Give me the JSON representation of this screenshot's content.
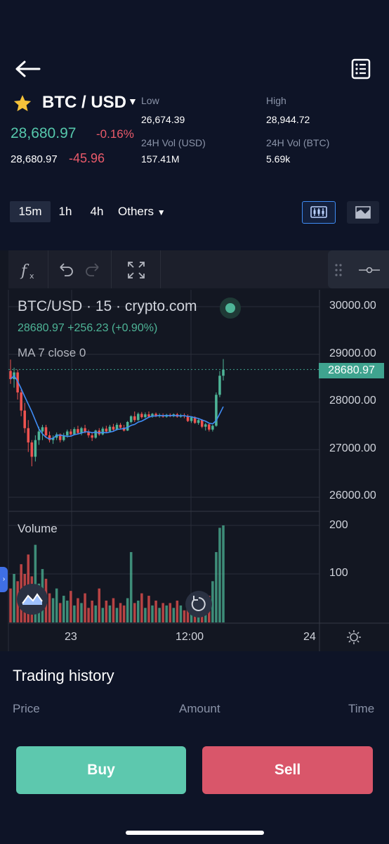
{
  "header": {
    "back_icon": "arrow-left-icon",
    "menu_icon": "order-list-icon",
    "favorite_icon": "star-icon",
    "pair": "BTC / USD",
    "last_price": "28,680.97",
    "change_pct": "-0.16%",
    "mark_price": "28,680.97",
    "change_abs": "-45.96",
    "stats": {
      "low_label": "Low",
      "low_value": "26,674.39",
      "high_label": "High",
      "high_value": "28,944.72",
      "vol_usd_label": "24H Vol (USD)",
      "vol_usd_value": "157.41M",
      "vol_btc_label": "24H Vol (BTC)",
      "vol_btc_value": "5.69k"
    }
  },
  "intervals": {
    "items": [
      "15m",
      "1h",
      "4h",
      "Others"
    ],
    "active": "15m"
  },
  "chart_toolbar": {
    "indicator_icon": "function-fx-icon",
    "undo_icon": "undo-icon",
    "redo_icon": "redo-icon",
    "fullscreen_icon": "fullscreen-icon",
    "drag_icon": "drag-handle-icon",
    "drawing_icon": "horizontal-line-tool-icon"
  },
  "chart": {
    "legend_title": "BTC/USD · 15 · crypto.com",
    "legend_quote": "28680.97 +256.23 (+0.90%)",
    "legend_ma": "MA 7 close 0",
    "current_price_tag": "28680.97",
    "volume_label": "Volume",
    "y_ticks": [
      "30000.00",
      "29000.00",
      "28000.00",
      "27000.00",
      "26000.00"
    ],
    "volume_ticks": [
      "200",
      "100"
    ],
    "x_ticks": [
      "23",
      "12:00",
      "24"
    ]
  },
  "chart_data": {
    "type": "candlestick",
    "symbol": "BTC/USD",
    "interval": "15",
    "ylim": [
      25700,
      30400
    ],
    "current_price": 28680.97,
    "ma": {
      "name": "MA 7 close 0",
      "period": 7,
      "color": "#3f8cf5"
    },
    "colors": {
      "up": "#4eb597",
      "down": "#ef5350"
    },
    "candles": [
      {
        "o": 28650,
        "h": 28890,
        "c": 28480,
        "l": 28380
      },
      {
        "o": 28480,
        "h": 28720,
        "c": 28620,
        "l": 28300
      },
      {
        "o": 28620,
        "h": 28680,
        "c": 28200,
        "l": 28050
      },
      {
        "o": 28200,
        "h": 28260,
        "c": 27820,
        "l": 27700
      },
      {
        "o": 27820,
        "h": 27980,
        "c": 27450,
        "l": 27350
      },
      {
        "o": 27450,
        "h": 27620,
        "c": 27150,
        "l": 26950
      },
      {
        "o": 27150,
        "h": 27200,
        "c": 26850,
        "l": 26650
      },
      {
        "o": 26850,
        "h": 27300,
        "c": 27200,
        "l": 26750
      },
      {
        "o": 27200,
        "h": 27480,
        "c": 27380,
        "l": 27100
      },
      {
        "o": 27380,
        "h": 27520,
        "c": 27470,
        "l": 27200
      },
      {
        "o": 27470,
        "h": 27520,
        "c": 27300,
        "l": 27250
      },
      {
        "o": 27300,
        "h": 27380,
        "c": 27200,
        "l": 27150
      },
      {
        "o": 27200,
        "h": 27300,
        "c": 27250,
        "l": 27120
      },
      {
        "o": 27250,
        "h": 27360,
        "c": 27320,
        "l": 27200
      },
      {
        "o": 27320,
        "h": 27340,
        "c": 27200,
        "l": 27150
      },
      {
        "o": 27200,
        "h": 27350,
        "c": 27300,
        "l": 27170
      },
      {
        "o": 27300,
        "h": 27420,
        "c": 27380,
        "l": 27250
      },
      {
        "o": 27380,
        "h": 27430,
        "c": 27320,
        "l": 27280
      },
      {
        "o": 27320,
        "h": 27470,
        "c": 27430,
        "l": 27300
      },
      {
        "o": 27430,
        "h": 27500,
        "c": 27350,
        "l": 27320
      },
      {
        "o": 27350,
        "h": 27480,
        "c": 27450,
        "l": 27300
      },
      {
        "o": 27450,
        "h": 27520,
        "c": 27380,
        "l": 27340
      },
      {
        "o": 27380,
        "h": 27420,
        "c": 27300,
        "l": 27250
      },
      {
        "o": 27300,
        "h": 27360,
        "c": 27250,
        "l": 27180
      },
      {
        "o": 27250,
        "h": 27420,
        "c": 27400,
        "l": 27230
      },
      {
        "o": 27400,
        "h": 27450,
        "c": 27320,
        "l": 27290
      },
      {
        "o": 27320,
        "h": 27480,
        "c": 27440,
        "l": 27300
      },
      {
        "o": 27440,
        "h": 27500,
        "c": 27380,
        "l": 27350
      },
      {
        "o": 27380,
        "h": 27520,
        "c": 27480,
        "l": 27360
      },
      {
        "o": 27480,
        "h": 27540,
        "c": 27420,
        "l": 27390
      },
      {
        "o": 27420,
        "h": 27560,
        "c": 27520,
        "l": 27400
      },
      {
        "o": 27520,
        "h": 27560,
        "c": 27460,
        "l": 27430
      },
      {
        "o": 27460,
        "h": 27520,
        "c": 27400,
        "l": 27380
      },
      {
        "o": 27400,
        "h": 27600,
        "c": 27580,
        "l": 27390
      },
      {
        "o": 27580,
        "h": 27720,
        "c": 27700,
        "l": 27550
      },
      {
        "o": 27700,
        "h": 27800,
        "c": 27620,
        "l": 27580
      },
      {
        "o": 27620,
        "h": 27780,
        "c": 27750,
        "l": 27600
      },
      {
        "o": 27750,
        "h": 27790,
        "c": 27680,
        "l": 27650
      },
      {
        "o": 27680,
        "h": 27780,
        "c": 27740,
        "l": 27660
      },
      {
        "o": 27740,
        "h": 27800,
        "c": 27690,
        "l": 27670
      },
      {
        "o": 27690,
        "h": 27770,
        "c": 27750,
        "l": 27670
      },
      {
        "o": 27750,
        "h": 27780,
        "c": 27700,
        "l": 27680
      },
      {
        "o": 27700,
        "h": 27760,
        "c": 27720,
        "l": 27670
      },
      {
        "o": 27720,
        "h": 27760,
        "c": 27690,
        "l": 27670
      },
      {
        "o": 27690,
        "h": 27750,
        "c": 27730,
        "l": 27670
      },
      {
        "o": 27730,
        "h": 27760,
        "c": 27700,
        "l": 27680
      },
      {
        "o": 27700,
        "h": 27760,
        "c": 27740,
        "l": 27680
      },
      {
        "o": 27740,
        "h": 27770,
        "c": 27690,
        "l": 27670
      },
      {
        "o": 27690,
        "h": 27750,
        "c": 27720,
        "l": 27670
      },
      {
        "o": 27720,
        "h": 27760,
        "c": 27700,
        "l": 27660
      },
      {
        "o": 27700,
        "h": 27740,
        "c": 27600,
        "l": 27580
      },
      {
        "o": 27600,
        "h": 27700,
        "c": 27680,
        "l": 27560
      },
      {
        "o": 27680,
        "h": 27700,
        "c": 27560,
        "l": 27540
      },
      {
        "o": 27560,
        "h": 27650,
        "c": 27620,
        "l": 27520
      },
      {
        "o": 27620,
        "h": 27640,
        "c": 27480,
        "l": 27450
      },
      {
        "o": 27480,
        "h": 27560,
        "c": 27530,
        "l": 27400
      },
      {
        "o": 27530,
        "h": 27560,
        "c": 27420,
        "l": 27380
      },
      {
        "o": 27420,
        "h": 27520,
        "c": 27500,
        "l": 27380
      },
      {
        "o": 27500,
        "h": 28200,
        "c": 28150,
        "l": 27480
      },
      {
        "o": 28150,
        "h": 28650,
        "c": 28550,
        "l": 28100
      },
      {
        "o": 28550,
        "h": 28900,
        "c": 28680,
        "l": 28450
      }
    ],
    "volumes": [
      70,
      100,
      85,
      120,
      100,
      140,
      95,
      160,
      80,
      110,
      90,
      60,
      50,
      70,
      40,
      55,
      45,
      65,
      35,
      50,
      40,
      60,
      30,
      45,
      35,
      70,
      30,
      45,
      35,
      50,
      30,
      40,
      35,
      50,
      145,
      40,
      45,
      60,
      30,
      55,
      35,
      45,
      30,
      40,
      35,
      40,
      30,
      45,
      35,
      25,
      40,
      45,
      30,
      35,
      60,
      45,
      55,
      85,
      145,
      195,
      200
    ]
  },
  "trading_history": {
    "title": "Trading history",
    "col_price": "Price",
    "col_amount": "Amount",
    "col_time": "Time"
  },
  "actions": {
    "buy": "Buy",
    "sell": "Sell"
  }
}
